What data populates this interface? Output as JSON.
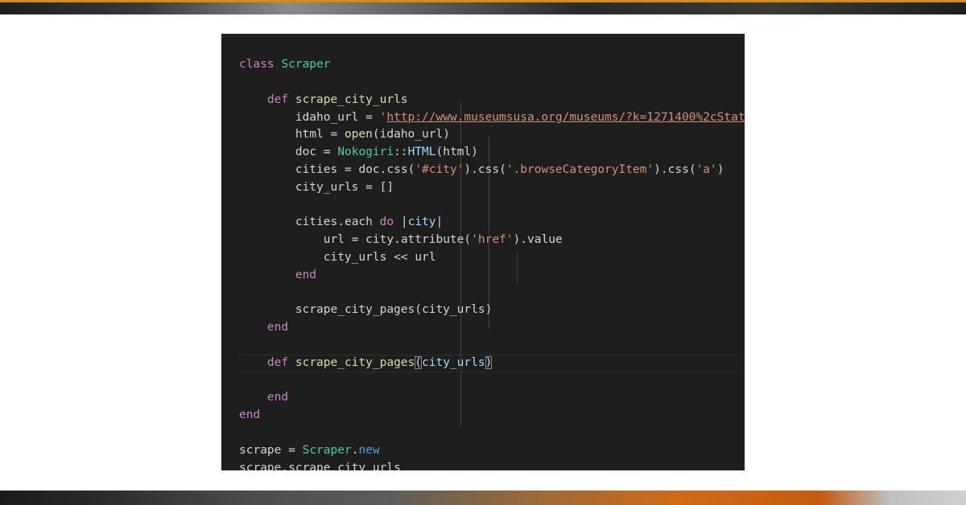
{
  "editor": {
    "lines": [
      "",
      "class Scraper",
      "",
      "    def scrape_city_urls",
      "        idaho_url = 'http://www.museumsusa.org/museums/?k=1271400%2cStat",
      "        html = open(idaho_url)",
      "        doc = Nokogiri::HTML(html)",
      "        cities = doc.css('#city').css('.browseCategoryItem').css('a')",
      "        city_urls = []",
      "",
      "        cities.each do |city|",
      "            url = city.attribute('href').value",
      "            city_urls << url",
      "        end",
      "",
      "        scrape_city_pages(city_urls)",
      "    end",
      "",
      "    def scrape_city_pages(city_urls)",
      "",
      "    end",
      "end",
      "",
      "scrape = Scraper.new",
      "scrape.scrape_city_urls"
    ]
  },
  "tokens": {
    "class": "class",
    "scraper": "Scraper",
    "def": "def",
    "end": "end",
    "do": "do",
    "scrape_city_urls": "scrape_city_urls",
    "idaho_url": "idaho_url",
    "eq": " = ",
    "url_string": "http://www.museumsusa.org/museums/?k=1271400%2cStat",
    "html": "html",
    "open": "open",
    "doc": "doc",
    "nokogiri": "Nokogiri",
    "dcolon": "::",
    "HTML": "HTML",
    "cities": "cities",
    "css": "css",
    "city_sel": "'#city'",
    "browse_sel": "'.browseCategoryItem'",
    "a_sel": "'a'",
    "city_urls": "city_urls",
    "empty_arr": "[]",
    "each": "each",
    "city": "city",
    "url": "url",
    "attribute": "attribute",
    "href": "'href'",
    "value": "value",
    "shovel": " << ",
    "scrape_city_pages": "scrape_city_pages",
    "scrape": "scrape",
    "new": "new"
  },
  "colors": {
    "background": "#1e1e1e",
    "keyword": "#c586c0",
    "class_name": "#4ec9b0",
    "function": "#dcdcaa",
    "string": "#ce9178",
    "variable": "#9cdcfe",
    "default_text": "#d4d4d4",
    "top_accent": "#d98a1c"
  }
}
